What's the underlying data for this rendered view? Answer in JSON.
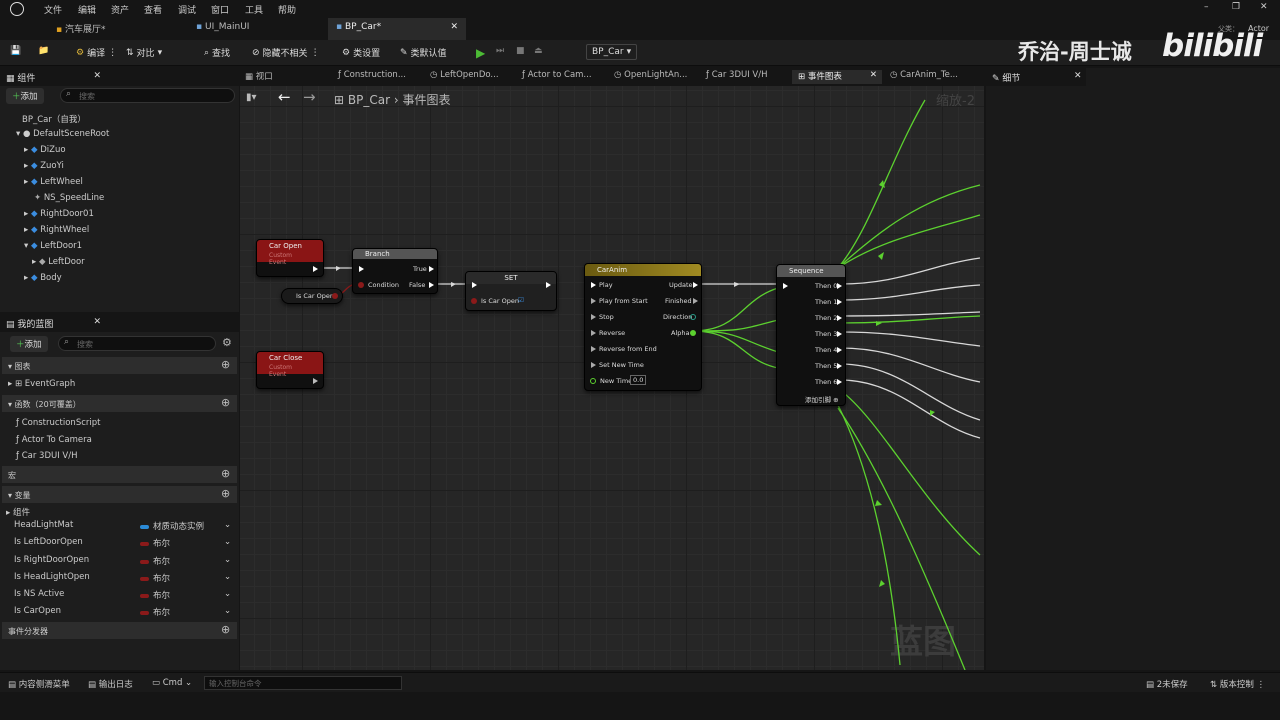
{
  "menu": [
    "文件",
    "编辑",
    "资产",
    "查看",
    "调试",
    "窗口",
    "工具",
    "帮助"
  ],
  "tabs": [
    "汽车展厅*",
    "UI_MainUI",
    "BP_Car*"
  ],
  "toolbar": {
    "compile": "编译",
    "diff": "对比",
    "find": "查找",
    "hide": "隐藏不相关",
    "class_settings": "类设置",
    "class_defaults": "类默认值",
    "debug_object": "BP_Car"
  },
  "window_right": {
    "label1": "父类：",
    "label2": "Actor"
  },
  "watermark": {
    "author": "乔治-周士诚",
    "site": "bilibili",
    "graph": "蓝图",
    "zoom": "缩放-2"
  },
  "components": {
    "title": "组件",
    "add": "添加",
    "search_placeholder": "搜索",
    "items": [
      "BP_Car（自我）",
      "DefaultSceneRoot",
      "DiZuo",
      "ZuoYi",
      "LeftWheel",
      "NS_SpeedLine",
      "RightDoor01",
      "RightWheel",
      "LeftDoor1",
      "LeftDoor",
      "Body"
    ]
  },
  "my_blueprint": {
    "title": "我的蓝图",
    "add": "添加",
    "search_placeholder": "搜索",
    "graphs_header": "图表",
    "event_graph": "EventGraph",
    "functions_header": "函数（20可覆盖）",
    "functions": [
      "ConstructionScript",
      "Actor To Camera",
      "Car 3DUI V/H"
    ],
    "macros_header": "宏",
    "variables_header": "变量",
    "components_label": "组件",
    "variables": [
      {
        "name": "HeadLightMat",
        "type": "材质动态实例",
        "color": "#2b8ad6"
      },
      {
        "name": "Is LeftDoorOpen",
        "type": "布尔",
        "color": "#8b1a1a"
      },
      {
        "name": "Is RightDoorOpen",
        "type": "布尔",
        "color": "#8b1a1a"
      },
      {
        "name": "Is HeadLightOpen",
        "type": "布尔",
        "color": "#8b1a1a"
      },
      {
        "name": "Is NS Active",
        "type": "布尔",
        "color": "#8b1a1a"
      },
      {
        "name": "Is CarOpen",
        "type": "布尔",
        "color": "#8b1a1a"
      }
    ],
    "dispatchers_header": "事件分发器"
  },
  "graph_tabs": [
    "视口",
    "Construction...",
    "LeftOpenDo...",
    "Actor to Cam...",
    "OpenLightAn...",
    "Car 3DUI V/H",
    "事件图表",
    "CarAnim_Te..."
  ],
  "details": {
    "title": "细节"
  },
  "breadcrumb": {
    "root": "BP_Car",
    "current": "事件图表"
  },
  "nodes": {
    "car_open": {
      "title": "Car Open",
      "sub": "Custom Event"
    },
    "is_car_open_get": {
      "title": "Is Car Open"
    },
    "branch": {
      "title": "Branch",
      "true": "True",
      "condition": "Condition",
      "false": "False"
    },
    "set": {
      "title": "SET",
      "var": "Is Car Open"
    },
    "car_close": {
      "title": "Car Close",
      "sub": "Custom Event"
    },
    "timeline": {
      "title": "CarAnim",
      "inputs": [
        "Play",
        "Play from Start",
        "Stop",
        "Reverse",
        "Reverse from End",
        "Set New Time",
        "New Time"
      ],
      "outputs": [
        "Update",
        "Finished",
        "Direction",
        "Alpha"
      ],
      "new_time": "0.0"
    },
    "sequence": {
      "title": "Sequence",
      "outputs": [
        "Then 0",
        "Then 1",
        "Then 2",
        "Then 3",
        "Then 4",
        "Then 5",
        "Then 6"
      ],
      "add_pin": "添加引脚"
    }
  },
  "status": {
    "drawer": "内容侧滑菜单",
    "log": "输出日志",
    "cmd": "Cmd",
    "cmd_placeholder": "输入控制台命令",
    "unsaved": "2未保存",
    "source_control": "版本控制"
  },
  "colors": {
    "accent": "#2b8ad6",
    "event_red": "#8a1515",
    "alpha_wire": "#5cd12f",
    "exec_wire": "#d8d8d8"
  }
}
